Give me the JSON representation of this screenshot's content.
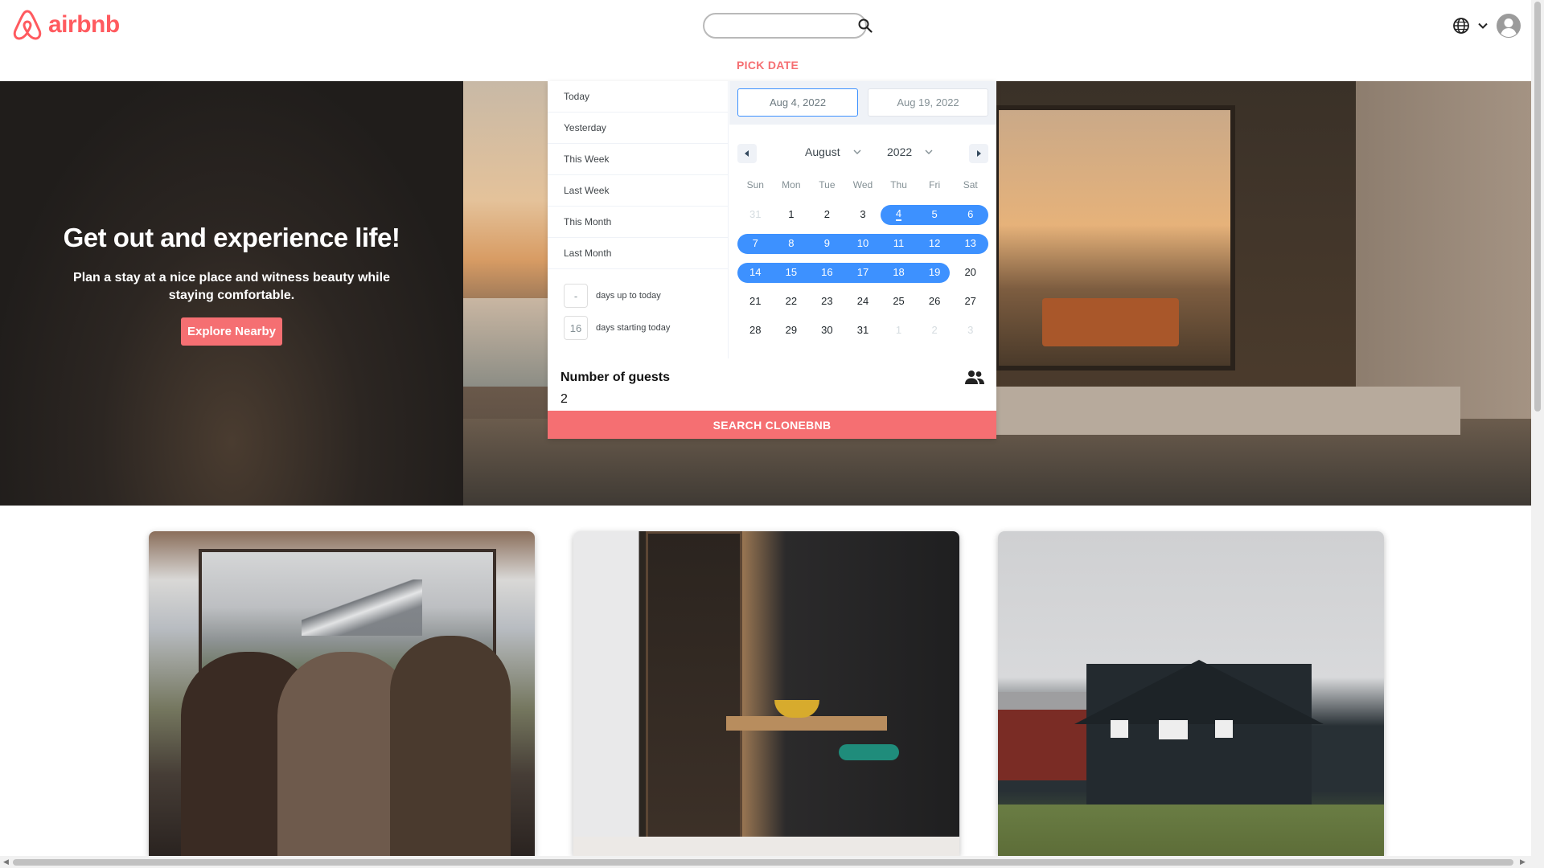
{
  "header": {
    "logo_text": "airbnb",
    "search_placeholder": "",
    "brand_color": "#ff5a5f"
  },
  "hero": {
    "title": "Get out and experience life!",
    "subtitle": "Plan a stay at a nice place and witness beauty while staying comfortable.",
    "cta_label": "Explore Nearby"
  },
  "picker": {
    "heading": "PICK DATE",
    "ranges": [
      "Today",
      "Yesterday",
      "This Week",
      "Last Week",
      "This Month",
      "Last Month"
    ],
    "input_ranges": [
      {
        "value": "-",
        "label": "days up to today"
      },
      {
        "value": "16",
        "label": "days starting today"
      }
    ],
    "start_date": "Aug 4, 2022",
    "end_date": "Aug 19, 2022",
    "month": "August",
    "year": "2022",
    "weekdays": [
      "Sun",
      "Mon",
      "Tue",
      "Wed",
      "Thu",
      "Fri",
      "Sat"
    ],
    "weeks": [
      [
        "31",
        "1",
        "2",
        "3",
        "4",
        "5",
        "6"
      ],
      [
        "7",
        "8",
        "9",
        "10",
        "11",
        "12",
        "13"
      ],
      [
        "14",
        "15",
        "16",
        "17",
        "18",
        "19",
        "20"
      ],
      [
        "21",
        "22",
        "23",
        "24",
        "25",
        "26",
        "27"
      ],
      [
        "28",
        "29",
        "30",
        "31",
        "1",
        "2",
        "3"
      ]
    ],
    "selection_color": "#3d91ff"
  },
  "guests": {
    "label": "Number of guests",
    "value": "2"
  },
  "search_button_label": "SEARCH CLONEBNB",
  "accent_color": "#f56f72"
}
